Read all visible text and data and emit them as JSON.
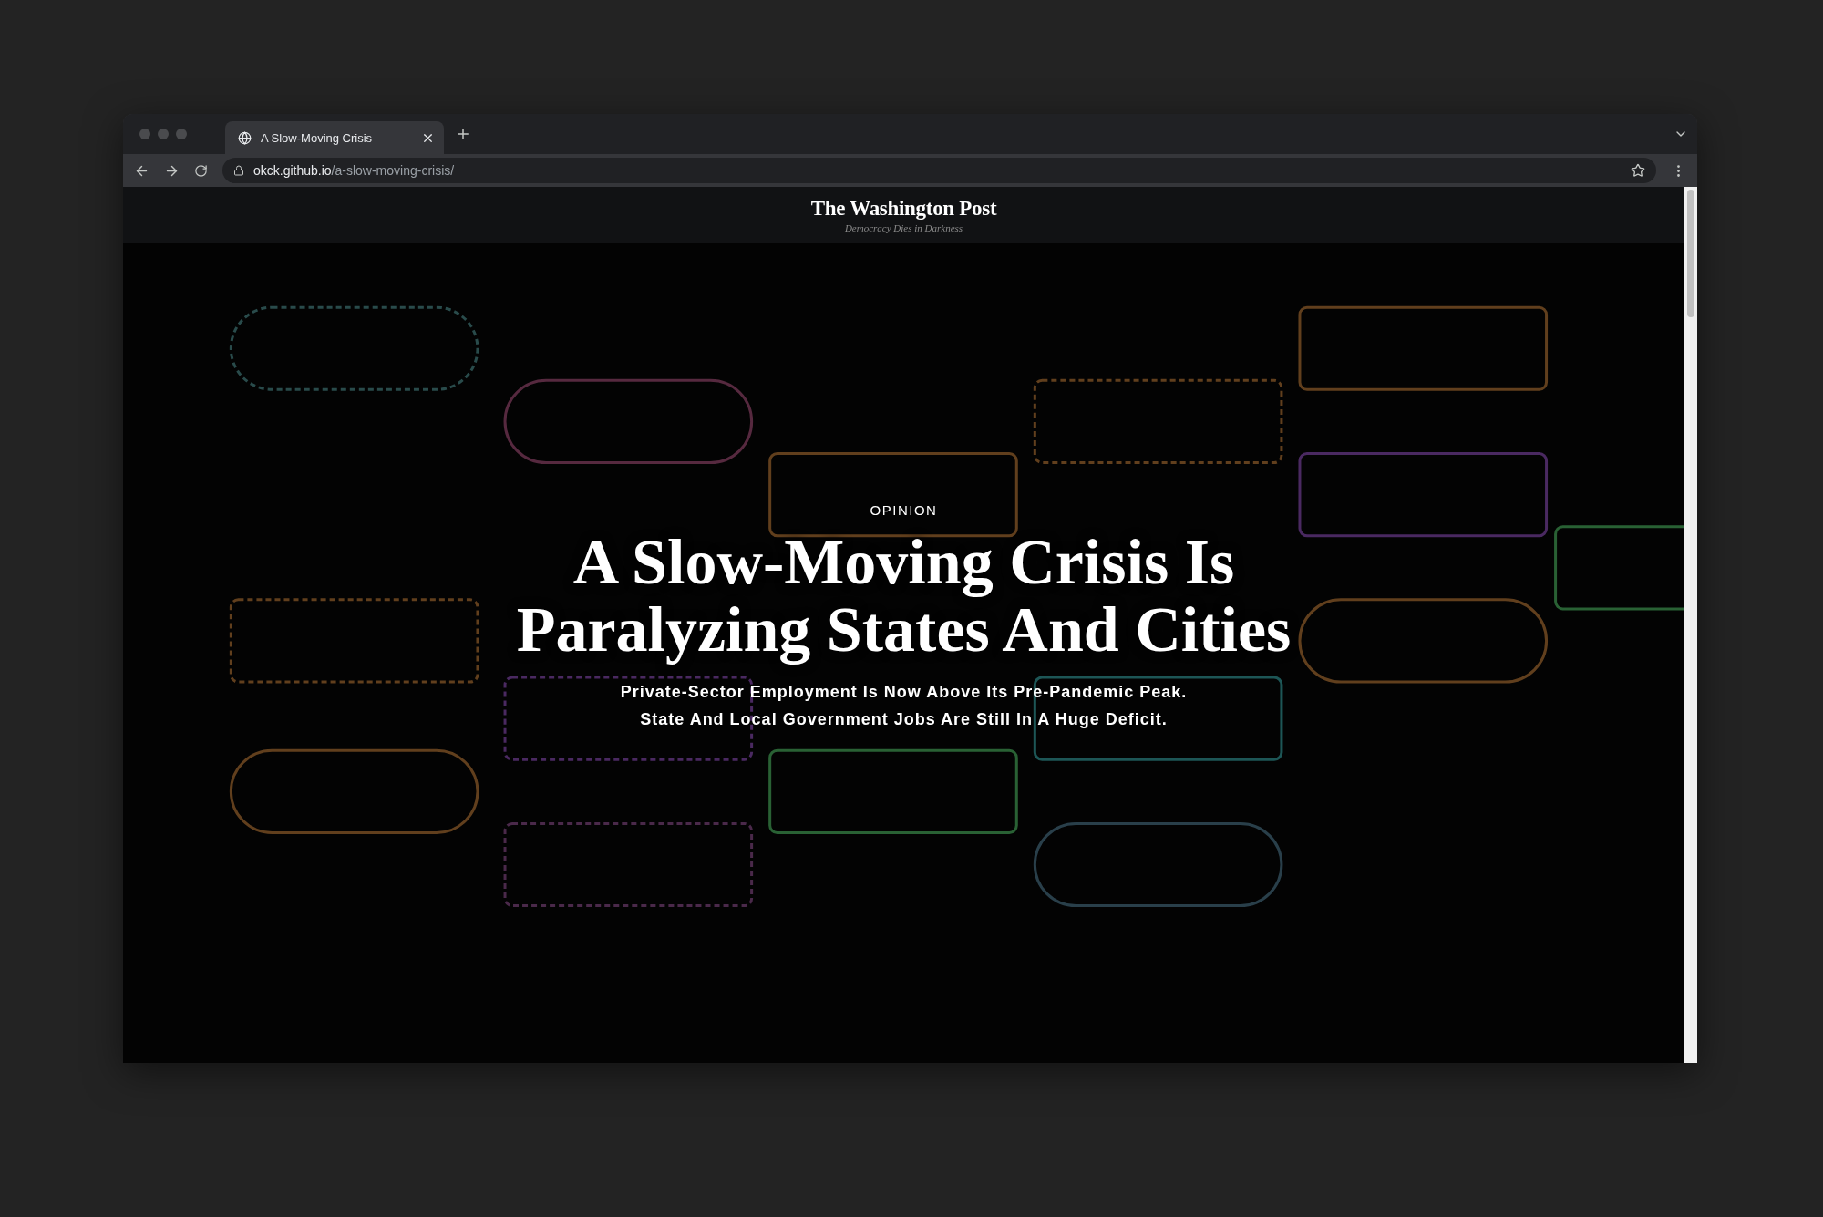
{
  "tab": {
    "title": "A Slow-Moving Crisis",
    "selected": true
  },
  "address_bar": {
    "host": "okck.github.io",
    "path": "/a-slow-moving-crisis/"
  },
  "masthead": {
    "logo": "The Washington Post",
    "tagline": "Democracy Dies in Darkness"
  },
  "hero": {
    "kicker": "OPINION",
    "headline": [
      "A Slow-Moving Crisis Is",
      "Paralyzing States And Cities"
    ],
    "deck": [
      "Private-Sector Employment Is Now Above Its Pre-Pandemic Peak.",
      "State And Local Government Jobs Are Still In A Huge Deficit."
    ]
  }
}
